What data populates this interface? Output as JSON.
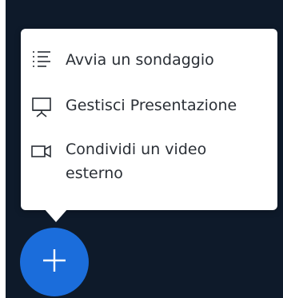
{
  "menu": {
    "items": [
      {
        "label": "Avvia un sondaggio",
        "icon": "poll-list-icon"
      },
      {
        "label": "Gestisci Presentazione",
        "icon": "presentation-icon"
      },
      {
        "label": "Condividi un video esterno",
        "icon": "video-camera-icon"
      }
    ]
  },
  "fab": {
    "icon": "plus-icon"
  },
  "colors": {
    "background": "#0e1a2a",
    "menu_background": "#ffffff",
    "fab": "#1b6ddb",
    "text": "#2a2f36"
  }
}
